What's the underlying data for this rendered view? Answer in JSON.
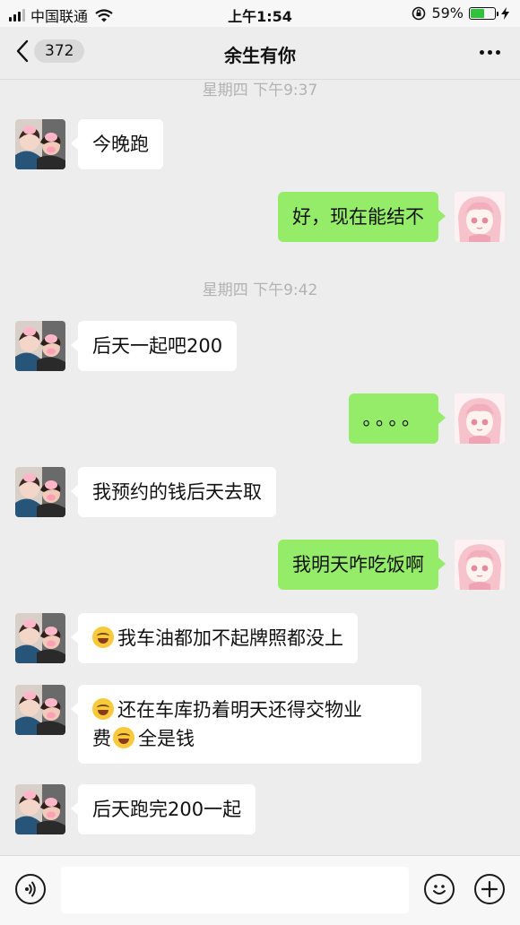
{
  "status_bar": {
    "carrier": "中国联通",
    "time": "上午1:54",
    "battery_percent": "59%",
    "battery_level": 0.59
  },
  "nav": {
    "back_count": "372",
    "title": "余生有你"
  },
  "messages": [
    {
      "type": "time",
      "text": "星期四 下午9:37"
    },
    {
      "type": "msg",
      "side": "left",
      "text": "今晚跑"
    },
    {
      "type": "msg",
      "side": "right",
      "text": "好，现在能结不"
    },
    {
      "type": "time",
      "text": "星期四 下午9:42"
    },
    {
      "type": "msg",
      "side": "left",
      "text": "后天一起吧200"
    },
    {
      "type": "msg",
      "side": "right",
      "text": "。。。。"
    },
    {
      "type": "msg",
      "side": "left",
      "text": "我预约的钱后天去取"
    },
    {
      "type": "msg",
      "side": "right",
      "text": "我明天咋吃饭啊"
    },
    {
      "type": "msg",
      "side": "left",
      "emoji_prefix": "grimace-emoji",
      "text": "我车油都加不起牌照都没上"
    },
    {
      "type": "msg",
      "side": "left",
      "emoji_prefix": "grimace-emoji",
      "text": "还在车库扔着明天还得交物业",
      "text2": "费",
      "emoji_mid": "grimace-emoji",
      "text3": "全是钱"
    },
    {
      "type": "msg",
      "side": "left",
      "text": "后天跑完200一起"
    }
  ],
  "input": {
    "value": ""
  },
  "icons": {
    "back": "chevron-left-icon",
    "more": "more-dots-icon",
    "voice": "voice-icon",
    "emoji": "smiley-icon",
    "plus": "plus-icon"
  },
  "colors": {
    "outgoing_bubble": "#95ec69",
    "incoming_bubble": "#ffffff",
    "background": "#ededed"
  }
}
